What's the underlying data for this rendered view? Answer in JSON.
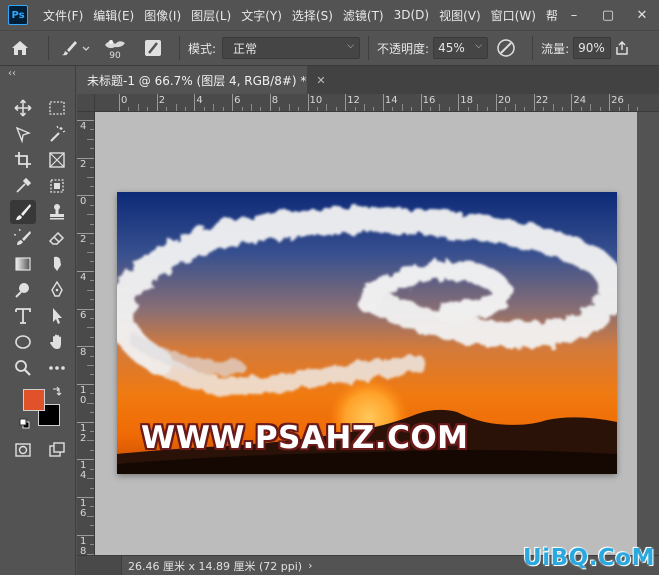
{
  "menubar": {
    "logo": "Ps",
    "items": [
      "文件(F)",
      "编辑(E)",
      "图像(I)",
      "图层(L)",
      "文字(Y)",
      "选择(S)",
      "滤镜(T)",
      "3D(D)",
      "视图(V)",
      "窗口(W)",
      "帮"
    ],
    "controls": {
      "minimize": "–",
      "restore": "▢",
      "close": "✕"
    }
  },
  "options": {
    "brush_size": "90",
    "mode_label": "模式:",
    "mode_value": "正常",
    "opacity_label": "不透明度:",
    "opacity_value": "45%",
    "flow_label": "流量:",
    "flow_value": "90%"
  },
  "toolbar": {
    "collapse": "‹‹",
    "foreground_color": "#e0522a",
    "background_color": "#000000"
  },
  "document": {
    "tab_title": "未标题-1 @ 66.7% (图层 4, RGB/8#) *",
    "tab_close": "✕"
  },
  "rulers": {
    "horizontal": [
      "0",
      "2",
      "4",
      "6",
      "8",
      "10",
      "12",
      "14",
      "16",
      "18",
      "20",
      "22",
      "24",
      "26"
    ],
    "vertical": [
      "4",
      "2",
      "0",
      "2",
      "4",
      "6",
      "8",
      "1\n0",
      "1\n2",
      "1\n4",
      "1\n6",
      "1\n8"
    ]
  },
  "canvas": {
    "overlay_text": "WWW.PSAHZ.COM"
  },
  "statusbar": {
    "doc_size": "26.46 厘米 x 14.89 厘米 (72 ppi)",
    "arrow": "›"
  },
  "watermark": "UiBQ.CoM"
}
